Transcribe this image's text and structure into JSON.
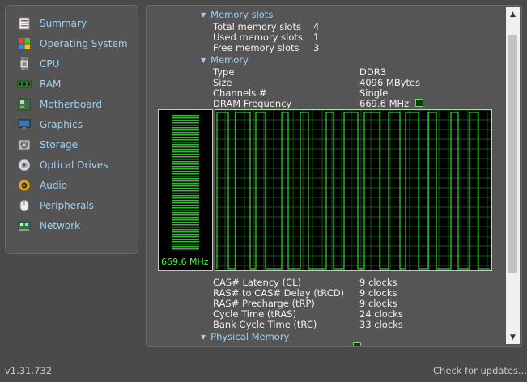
{
  "sidebar": {
    "items": [
      {
        "label": "Summary",
        "icon": "summary-icon"
      },
      {
        "label": "Operating System",
        "icon": "windows-icon"
      },
      {
        "label": "CPU",
        "icon": "cpu-icon"
      },
      {
        "label": "RAM",
        "icon": "ram-icon"
      },
      {
        "label": "Motherboard",
        "icon": "motherboard-icon"
      },
      {
        "label": "Graphics",
        "icon": "monitor-icon"
      },
      {
        "label": "Storage",
        "icon": "hdd-icon"
      },
      {
        "label": "Optical Drives",
        "icon": "disc-icon"
      },
      {
        "label": "Audio",
        "icon": "speaker-icon"
      },
      {
        "label": "Peripherals",
        "icon": "mouse-icon"
      },
      {
        "label": "Network",
        "icon": "network-icon"
      }
    ]
  },
  "main": {
    "memory_slots": {
      "heading": "Memory slots",
      "rows": [
        {
          "label": "Total memory slots",
          "value": "4"
        },
        {
          "label": "Used memory slots",
          "value": "1"
        },
        {
          "label": "Free memory slots",
          "value": "3"
        }
      ]
    },
    "memory": {
      "heading": "Memory",
      "rows": [
        {
          "label": "Type",
          "value": "DDR3"
        },
        {
          "label": "Size",
          "value": "4096 MBytes"
        },
        {
          "label": "Channels #",
          "value": "Single"
        },
        {
          "label": "DRAM Frequency",
          "value": "669.6 MHz"
        }
      ]
    },
    "graph": {
      "frequency_readout": "669.6 MHz"
    },
    "timings": {
      "rows": [
        {
          "label": "CAS# Latency (CL)",
          "value": "9 clocks"
        },
        {
          "label": "RAS# to CAS# Delay (tRCD)",
          "value": "9 clocks"
        },
        {
          "label": "RAS# Precharge (tRP)",
          "value": "9 clocks"
        },
        {
          "label": "Cycle Time (tRAS)",
          "value": "24 clocks"
        },
        {
          "label": "Bank Cycle Time (tRC)",
          "value": "33 clocks"
        }
      ]
    },
    "physical_memory": {
      "heading": "Physical Memory"
    }
  },
  "footer": {
    "version": "v1.31.732",
    "update_link": "Check for updates..."
  },
  "colors": {
    "accent": "#9fd0f2",
    "graph_green": "#39ff39",
    "panel_bg": "#555555",
    "window_bg": "#4a4a4a"
  }
}
